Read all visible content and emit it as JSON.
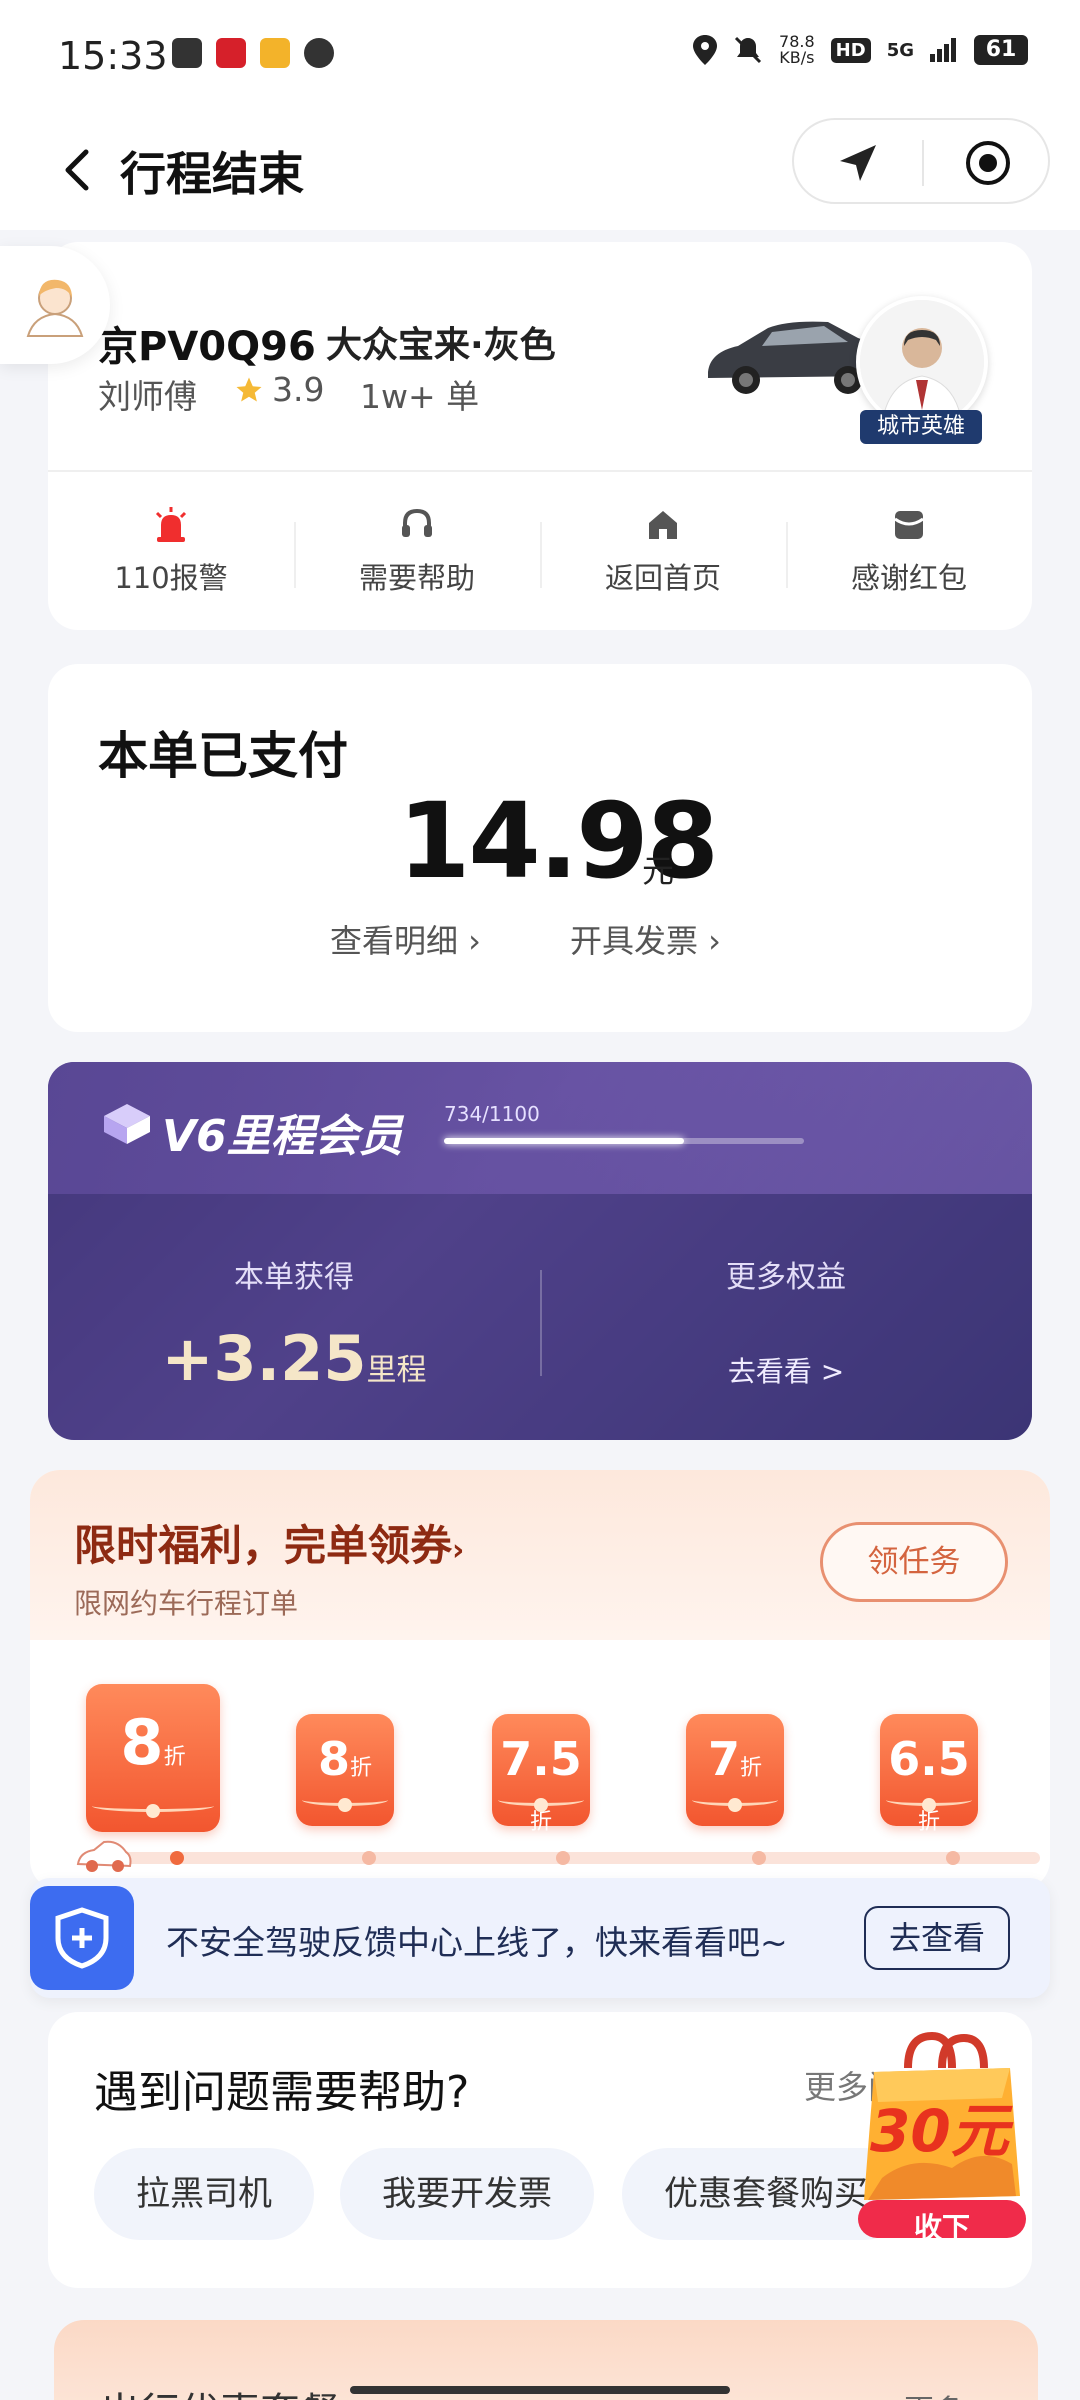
{
  "status_bar": {
    "time": "15:33",
    "speed_value": "78.8",
    "speed_unit": "KB/s",
    "hd": "HD",
    "network": "5G",
    "battery": "61"
  },
  "header": {
    "title": "行程结束"
  },
  "driver": {
    "plate": "京PV0Q96",
    "car_model": "大众宝来·灰色",
    "name": "刘师傅",
    "rating": "3.9",
    "orders": "1w+ 单",
    "badge": "城市英雄"
  },
  "actions": [
    {
      "label": "110报警",
      "icon": "alarm-icon"
    },
    {
      "label": "需要帮助",
      "icon": "headset-icon"
    },
    {
      "label": "返回首页",
      "icon": "home-icon"
    },
    {
      "label": "感谢红包",
      "icon": "red-packet-icon"
    }
  ],
  "payment": {
    "title": "本单已支付",
    "amount": "14.98",
    "unit": "元",
    "detail_link": "查看明细 ›",
    "invoice_link": "开具发票 ›"
  },
  "member": {
    "level": "V6",
    "title": "里程会员",
    "progress_label": "734/1100",
    "progress": 0.667,
    "earned_label": "本单获得",
    "earned_value": "+3.25",
    "earned_unit": "里程",
    "more_label": "更多权益",
    "more_link": "去看看 >"
  },
  "coupon": {
    "title": "限时福利，完单领券",
    "title_arrow": "›",
    "subtitle": "限网约车行程订单",
    "task_button": "领任务",
    "items": [
      {
        "value": "8",
        "unit": "折"
      },
      {
        "value": "8",
        "unit": "折"
      },
      {
        "value": "7.5",
        "unit": "折"
      },
      {
        "value": "7",
        "unit": "折"
      },
      {
        "value": "6.5",
        "unit": "折"
      }
    ]
  },
  "safety": {
    "text": "不安全驾驶反馈中心上线了，快来看看吧~",
    "button": "去查看"
  },
  "help": {
    "title": "遇到问题需要帮助?",
    "more": "更多问",
    "chips": [
      "拉黑司机",
      "我要开发票",
      "优惠套餐购买"
    ]
  },
  "float_packet": {
    "value": "30元",
    "button": "收下"
  },
  "bottom": {
    "title": "出行优惠套餐",
    "more": "更多"
  },
  "colors": {
    "accent": "#f2562f",
    "member_bg": "#4f3f86",
    "safety_blue": "#3d6cf0"
  }
}
